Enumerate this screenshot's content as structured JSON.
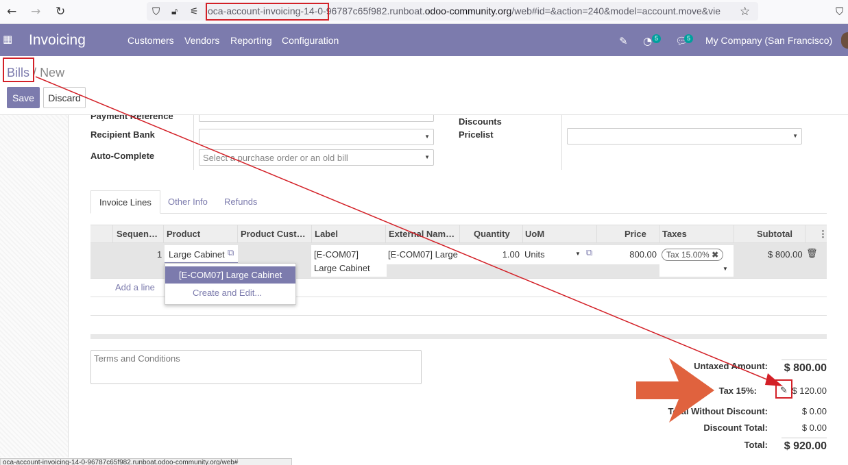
{
  "browser": {
    "url_host_prefix": "oca-account-invoicing-14-0-96787c65f982.runboat.",
    "url_domain": "odoo-community.org",
    "url_path": "/web#id=&action=240&model=account.move&vie"
  },
  "navbar": {
    "app_title": "Invoicing",
    "menu": [
      "Customers",
      "Vendors",
      "Reporting",
      "Configuration"
    ],
    "activity_count": "5",
    "message_count": "5",
    "company": "My Company (San Francisco)"
  },
  "breadcrumb": {
    "parent": "Bills",
    "separator": "/",
    "current": "New"
  },
  "buttons": {
    "save": "Save",
    "discard": "Discard"
  },
  "form": {
    "payment_reference_label": "Payment Reference",
    "recipient_bank_label": "Recipient Bank",
    "auto_complete_label": "Auto-Complete",
    "auto_complete_placeholder": "Select a purchase order or an old bill",
    "discounts_label": "Discounts",
    "pricelist_label": "Pricelist"
  },
  "tabs": [
    "Invoice Lines",
    "Other Info",
    "Refunds"
  ],
  "table": {
    "columns": [
      "Sequen…",
      "Product",
      "Product Cust…",
      "Label",
      "External Nam…",
      "Quantity",
      "UoM",
      "Price",
      "Taxes",
      "Subtotal"
    ],
    "row": {
      "sequence": "1",
      "product": "Large Cabinet",
      "label_line1": "[E-COM07]",
      "label_line2": "Large Cabinet",
      "external_name": "[E-COM07] Large",
      "quantity": "1.00",
      "uom": "Units",
      "price": "800.00",
      "tax": "Tax 15.00%",
      "subtotal": "$ 800.00"
    },
    "add_line": "Add a line"
  },
  "dropdown": {
    "option": "[E-COM07] Large Cabinet",
    "create": "Create and Edit..."
  },
  "terms_placeholder": "Terms and Conditions",
  "totals": {
    "untaxed_label": "Untaxed Amount:",
    "untaxed_value": "$ 800.00",
    "tax_label": "Tax 15%:",
    "tax_value": "$ 120.00",
    "total_wo_discount_label": "Total Without Discount:",
    "total_wo_discount_value": "$ 0.00",
    "discount_total_label": "Discount Total:",
    "discount_total_value": "$ 0.00",
    "total_label": "Total:",
    "total_value": "$ 920.00"
  },
  "status_bar": "oca-account-invoicing-14-0-96787c65f982.runboat.odoo-community.org/web#",
  "colors": {
    "primary": "#7c7bad",
    "annotation_red": "#d32027",
    "annotation_arrow": "#e0623e"
  }
}
